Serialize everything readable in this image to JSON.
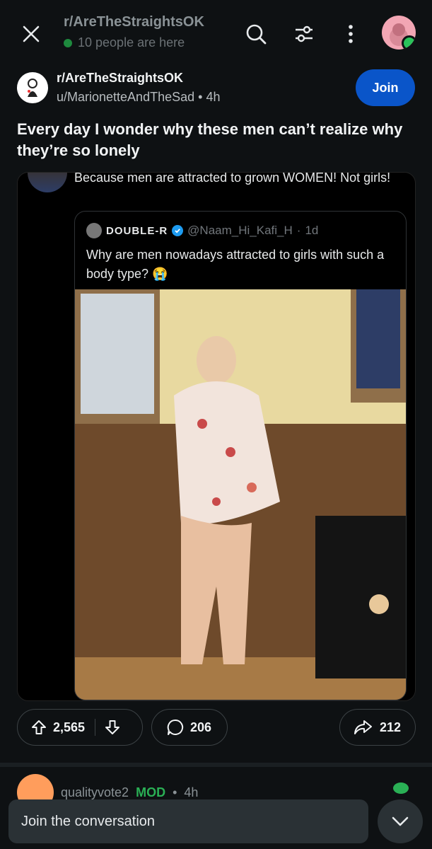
{
  "header": {
    "subreddit": "r/AreTheStraightsOK",
    "online_text": "10 people are here",
    "icons": [
      "close-icon",
      "search-icon",
      "filter-icon",
      "more-icon",
      "user-avatar"
    ]
  },
  "post": {
    "subreddit": "r/AreTheStraightsOK",
    "user": "u/MarionetteAndTheSad",
    "age": "4h",
    "join_label": "Join",
    "title": "Every day I wonder why these men can’t realize why they’re so lonely"
  },
  "tweet": {
    "reply_text": "Because men are attracted to grown WOMEN! Not girls!",
    "quoted": {
      "name": "DOUBLE-R",
      "handle": "@Naam_Hi_Kafi_H",
      "age": "1d",
      "text": "Why are men nowadays attracted to girls with such a body type? 😭"
    }
  },
  "actions": {
    "upvotes": "2,565",
    "comments": "206",
    "shares": "212"
  },
  "comment_preview": {
    "user": "qualityvote2",
    "badge": "MOD",
    "age": "4h"
  },
  "footer": {
    "join_conversation": "Join the conversation"
  },
  "colors": {
    "background": "#0e1113",
    "accent": "#0a55c9",
    "online": "#1e8a3e",
    "mod": "#2ab055"
  }
}
